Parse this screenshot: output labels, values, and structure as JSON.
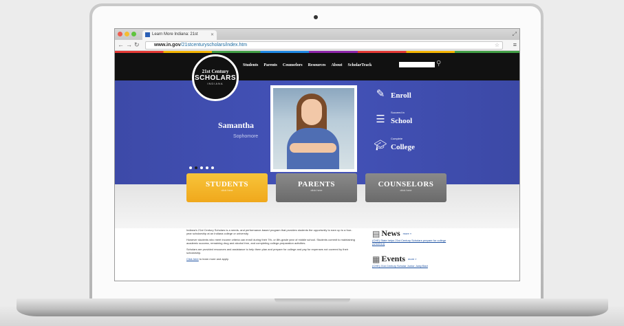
{
  "browser": {
    "tab_title": "Learn More Indiana: 21st",
    "url_domain": "www.in.gov",
    "url_path": "/21stcenturyscholars/index.htm"
  },
  "site": {
    "logo": {
      "line1": "21st Century",
      "line2": "SCHOLARS",
      "line3": "INDIANA"
    },
    "nav": [
      "Students",
      "Parents",
      "Counselors",
      "Resources",
      "About",
      "ScholarTrack"
    ],
    "hero": {
      "name": "Samantha",
      "grade": "Sophomore",
      "actions": [
        {
          "small": "",
          "big": "Enroll",
          "icon": "pencil-icon"
        },
        {
          "small": "Succeed in",
          "big": "School",
          "icon": "books-icon"
        },
        {
          "small": "Complete",
          "big": "College",
          "icon": "graduation-cap-icon"
        }
      ]
    },
    "audience_buttons": [
      {
        "title": "STUDENTS",
        "sub": "click here"
      },
      {
        "title": "PARENTS",
        "sub": "click here"
      },
      {
        "title": "COUNSELORS",
        "sub": "click here"
      }
    ],
    "intro": [
      "Indiana's 21st Century Scholars is a needs- and performance-based program that provides students the opportunity to earn up to a four-year scholarship at an Indiana college or university.",
      "However students who meet income criteria can enroll during their 7th- or 8th-grade year of middle school. Students commit to maintaining academic success, remaining drug and alcohol free, and completing college-preparation activities.",
      "Scholars are provided resources and assistance to help them plan and prepare for college and pay for expenses not covered by their scholarship."
    ],
    "intro_link": "Click here",
    "intro_link_tail": " to learn more and apply.",
    "news": {
      "title": "News",
      "more": "more »",
      "item": "(CHE) State helps 21st Century Scholars prepare for college (4/3/2014)"
    },
    "events": {
      "title": "Events",
      "more": "more »",
      "item": "(CHE) 21st Century Scholar Junior JumpStart"
    }
  }
}
